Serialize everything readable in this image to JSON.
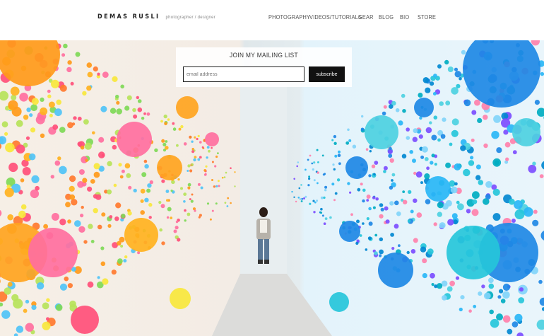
{
  "brand": {
    "name": "DEMAS RUSLI",
    "tagline": "photographer / designer"
  },
  "nav": {
    "items": [
      {
        "label": "PHOTOGRAPHY"
      },
      {
        "label": "VIDEOS/TUTORIALS"
      },
      {
        "label": "GEAR"
      },
      {
        "label": "BLOG"
      },
      {
        "label": "BIO"
      },
      {
        "label": "STORE"
      }
    ]
  },
  "mailing_list": {
    "title": "JOIN MY MAILING LIST",
    "email_placeholder": "email address",
    "email_value": "",
    "subscribe_label": "subscribe"
  },
  "hero": {
    "description": "balloon-installation-photo",
    "colors": {
      "warm": [
        "#ff9a1a",
        "#ff6fa0",
        "#ffb21f",
        "#7ed957",
        "#f7e73c",
        "#ff4f7a",
        "#4fc3f7",
        "#ff7a2f",
        "#b6e35a"
      ],
      "cool": [
        "#1e88e5",
        "#29b6f6",
        "#4dd0e1",
        "#26c6da",
        "#7c4dff",
        "#0288d1",
        "#81d4fa",
        "#ff80ab",
        "#00acc1"
      ]
    }
  }
}
